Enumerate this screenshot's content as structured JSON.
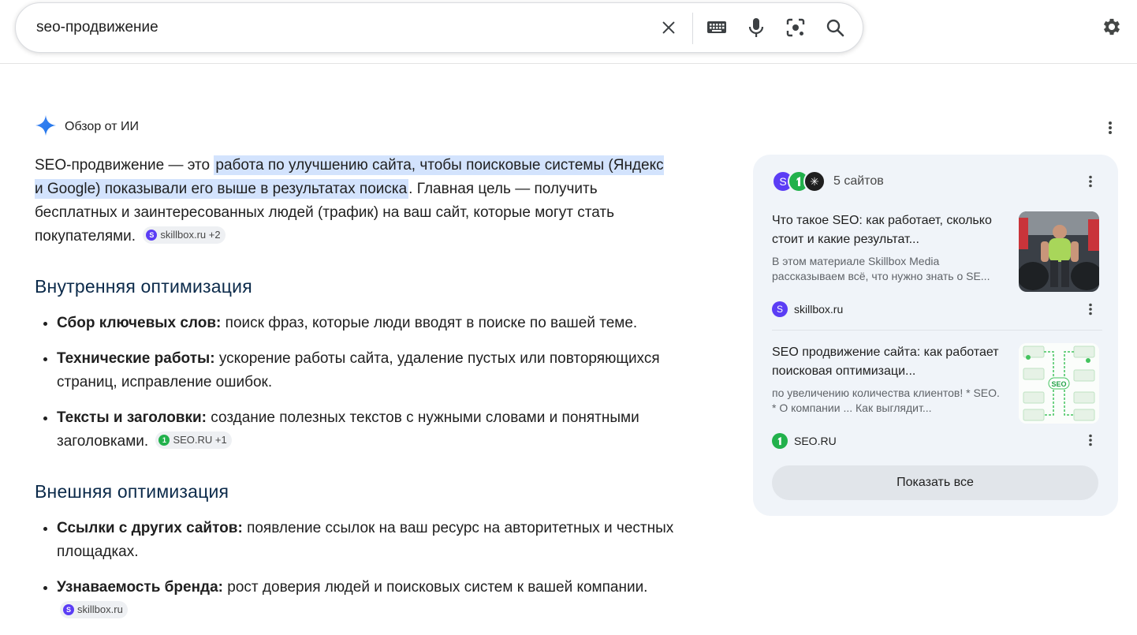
{
  "search": {
    "query": "seo-продвижение"
  },
  "ai_overview": {
    "header_title": "Обзор от ИИ",
    "intro": {
      "before": "SEO-продвижение — это ",
      "highlight": "работа по улучшению сайта, чтобы поисковые системы (Яндекс и Google) показывали его выше в результатах поиска",
      "after": ". Главная цель — получить бесплатных и заинтересованных людей (трафик) на ваш сайт, которые могут стать покупателями.",
      "chip": "skillbox.ru +2"
    },
    "sections": [
      {
        "title": "Внутренняя оптимизация",
        "items": [
          {
            "bold": "Сбор ключевых слов:",
            "text": " поиск фраз, которые люди вводят в поиске по вашей теме."
          },
          {
            "bold": "Технические работы:",
            "text": " ускорение работы сайта, удаление пустых или повторяющихся страниц, исправление ошибок."
          },
          {
            "bold": "Тексты и заголовки:",
            "text": " создание полезных текстов с нужными словами и понятными заголовками.",
            "chip": "SEO.RU +1"
          }
        ]
      },
      {
        "title": "Внешняя оптимизация",
        "items": [
          {
            "bold": "Ссылки с других сайтов:",
            "text": " появление ссылок на ваш ресурс на авторитетных и честных площадках."
          },
          {
            "bold": "Узнаваемость бренда:",
            "text": " рост доверия людей и поисковых систем к вашей компании.",
            "chip": "skillbox.ru"
          }
        ]
      }
    ]
  },
  "sources_card": {
    "count_label": "5 сайтов",
    "sources": [
      {
        "title": "Что такое SEO: как работает, сколько стоит и какие результат...",
        "snippet": "В этом материале Skillbox Media рассказываем всё, что нужно знать о SE...",
        "site": "skillbox.ru"
      },
      {
        "title": "SEO продвижение сайта: как работает поисковая оптимизаци...",
        "snippet": "по увеличению количества клиентов! * SEO. * О компании ... Как выглядит...",
        "site": "SEO.RU",
        "thumb_label": "SEO"
      }
    ],
    "show_all_label": "Показать все"
  },
  "colors": {
    "highlight": "#d3e3fd",
    "card_bg": "#f0f4f9",
    "skillbox": "#5b3df5",
    "seo_ru": "#22b14c",
    "heading": "#0b2a4a"
  },
  "icons": [
    "close-icon",
    "keyboard-icon",
    "microphone-icon",
    "lens-icon",
    "search-icon",
    "gear-icon",
    "gemini-sparkle-icon",
    "more-vert-icon"
  ]
}
